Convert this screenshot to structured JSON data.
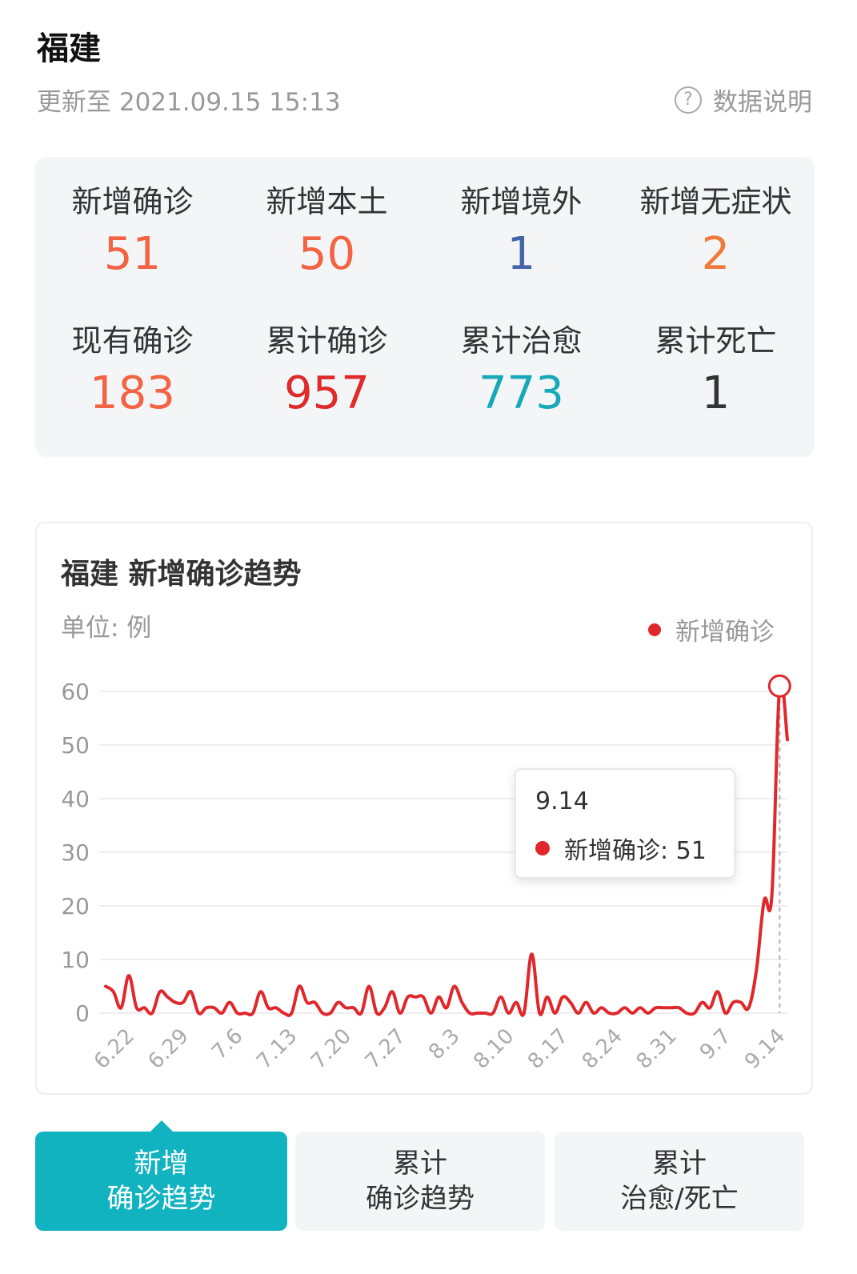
{
  "header": {
    "province": "福建",
    "update_time": "更新至 2021.09.15 15:13",
    "data_note": "数据说明",
    "help_icon_glyph": "?"
  },
  "stats": [
    {
      "label": "新增确诊",
      "value": "51",
      "color": "#f26444"
    },
    {
      "label": "新增本土",
      "value": "50",
      "color": "#f26444"
    },
    {
      "label": "新增境外",
      "value": "1",
      "color": "#4566a6"
    },
    {
      "label": "新增无症状",
      "value": "2",
      "color": "#f07a3c"
    },
    {
      "label": "现有确诊",
      "value": "183",
      "color": "#f26444"
    },
    {
      "label": "累计确诊",
      "value": "957",
      "color": "#e02b2b"
    },
    {
      "label": "累计治愈",
      "value": "773",
      "color": "#17a9b8"
    },
    {
      "label": "累计死亡",
      "value": "1",
      "color": "#333333"
    }
  ],
  "chart_card": {
    "title": "福建 新增确诊趋势",
    "unit": "单位: 例",
    "legend_label": "新增确诊",
    "line_color": "#e0282c",
    "tooltip": {
      "date": "9.14",
      "label": "新增确诊: 51"
    }
  },
  "chart_data": {
    "type": "line",
    "title": "福建 新增确诊趋势",
    "ylabel": "单位: 例",
    "ylim": [
      0,
      60
    ],
    "yticks": [
      0,
      10,
      20,
      30,
      40,
      50,
      60
    ],
    "grid": true,
    "legend": "top-right",
    "xtick_labels": [
      "6.22",
      "6.29",
      "7.6",
      "7.13",
      "7.20",
      "7.27",
      "8.3",
      "8.10",
      "8.17",
      "8.24",
      "8.31",
      "9.7",
      "9.14"
    ],
    "xtick_index": [
      3,
      10,
      17,
      24,
      31,
      38,
      45,
      52,
      59,
      66,
      73,
      80,
      87
    ],
    "series": [
      {
        "name": "新增确诊",
        "color": "#e0282c",
        "x": [
          "6.19",
          "6.20",
          "6.21",
          "6.22",
          "6.23",
          "6.24",
          "6.25",
          "6.26",
          "6.27",
          "6.28",
          "6.29",
          "6.30",
          "7.1",
          "7.2",
          "7.3",
          "7.4",
          "7.5",
          "7.6",
          "7.7",
          "7.8",
          "7.9",
          "7.10",
          "7.11",
          "7.12",
          "7.13",
          "7.14",
          "7.15",
          "7.16",
          "7.17",
          "7.18",
          "7.19",
          "7.20",
          "7.21",
          "7.22",
          "7.23",
          "7.24",
          "7.25",
          "7.26",
          "7.27",
          "7.28",
          "7.29",
          "7.30",
          "7.31",
          "8.1",
          "8.2",
          "8.3",
          "8.4",
          "8.5",
          "8.6",
          "8.7",
          "8.8",
          "8.9",
          "8.10",
          "8.11",
          "8.12",
          "8.13",
          "8.14",
          "8.15",
          "8.16",
          "8.17",
          "8.18",
          "8.19",
          "8.20",
          "8.21",
          "8.22",
          "8.23",
          "8.24",
          "8.25",
          "8.26",
          "8.27",
          "8.28",
          "8.29",
          "8.30",
          "8.31",
          "9.1",
          "9.2",
          "9.3",
          "9.4",
          "9.5",
          "9.6",
          "9.7",
          "9.8",
          "9.9",
          "9.10",
          "9.11",
          "9.12",
          "9.13",
          "9.14",
          "9.15"
        ],
        "values": [
          5,
          4,
          1,
          7,
          1,
          1,
          0,
          4,
          3,
          2,
          2,
          4,
          0,
          1,
          1,
          0,
          2,
          0,
          0,
          0,
          4,
          1,
          1,
          0,
          0,
          5,
          2,
          2,
          0,
          0,
          2,
          1,
          1,
          0,
          5,
          0,
          1,
          4,
          0,
          3,
          3,
          3,
          0,
          3,
          1,
          5,
          2,
          0,
          0,
          0,
          0,
          3,
          0,
          2,
          0,
          11,
          0,
          3,
          0,
          3,
          2,
          0,
          2,
          0,
          1,
          0,
          0,
          1,
          0,
          1,
          0,
          1,
          1,
          1,
          1,
          0,
          0,
          2,
          1,
          4,
          0,
          2,
          2,
          1,
          8,
          21,
          22,
          61,
          51
        ]
      }
    ]
  },
  "tabs": [
    {
      "line1": "新增",
      "line2": "确诊趋势",
      "active": true
    },
    {
      "line1": "累计",
      "line2": "确诊趋势",
      "active": false
    },
    {
      "line1": "累计",
      "line2": "治愈/死亡",
      "active": false
    }
  ]
}
